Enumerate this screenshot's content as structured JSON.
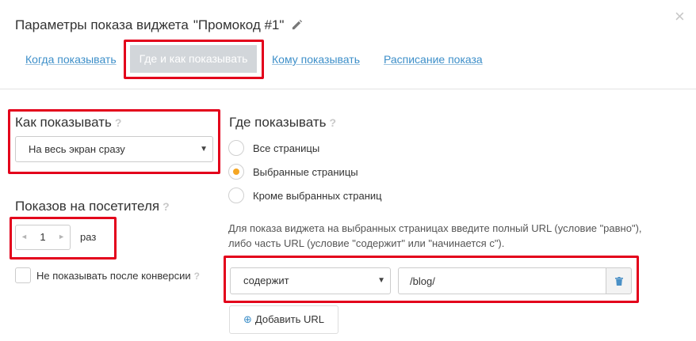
{
  "header": {
    "title": "Параметры показа виджета",
    "widget_name": "\"Промокод #1\""
  },
  "tabs": [
    {
      "label": "Когда показывать",
      "active": false
    },
    {
      "label": "Где и как показывать",
      "active": true
    },
    {
      "label": "Кому показывать",
      "active": false
    },
    {
      "label": "Расписание показа",
      "active": false
    }
  ],
  "how": {
    "heading": "Как показывать",
    "help": "?",
    "selected": "На весь экран сразу"
  },
  "views": {
    "heading": "Показов на посетителя",
    "help": "?",
    "dec": "◄",
    "inc": "►",
    "value": "1",
    "unit": "раз"
  },
  "conversion": {
    "label": "Не показывать после конверсии",
    "help": "?",
    "checked": false
  },
  "where": {
    "heading": "Где показывать",
    "help": "?",
    "options": [
      {
        "label": "Все страницы",
        "checked": false
      },
      {
        "label": "Выбранные страницы",
        "checked": true
      },
      {
        "label": "Кроме выбранных страниц",
        "checked": false
      }
    ],
    "info_line1": "Для показа виджета на выбранных страницах введите полный URL (условие \"равно\"),",
    "info_line2": "либо часть URL (условие \"содержит\" или \"начинается с\").",
    "condition": "содержит",
    "url_value": "/blog/",
    "add_button": "Добавить URL"
  },
  "colors": {
    "accent": "#3d8fc9",
    "highlight": "#e3001b",
    "active_tab": "#d2d6da",
    "radio_checked": "#f5a623"
  },
  "icons": {
    "edit": "pencil-icon",
    "close": "close-icon",
    "delete": "trash-icon",
    "add": "plus-icon",
    "dropdown": "chevron-down-icon"
  }
}
